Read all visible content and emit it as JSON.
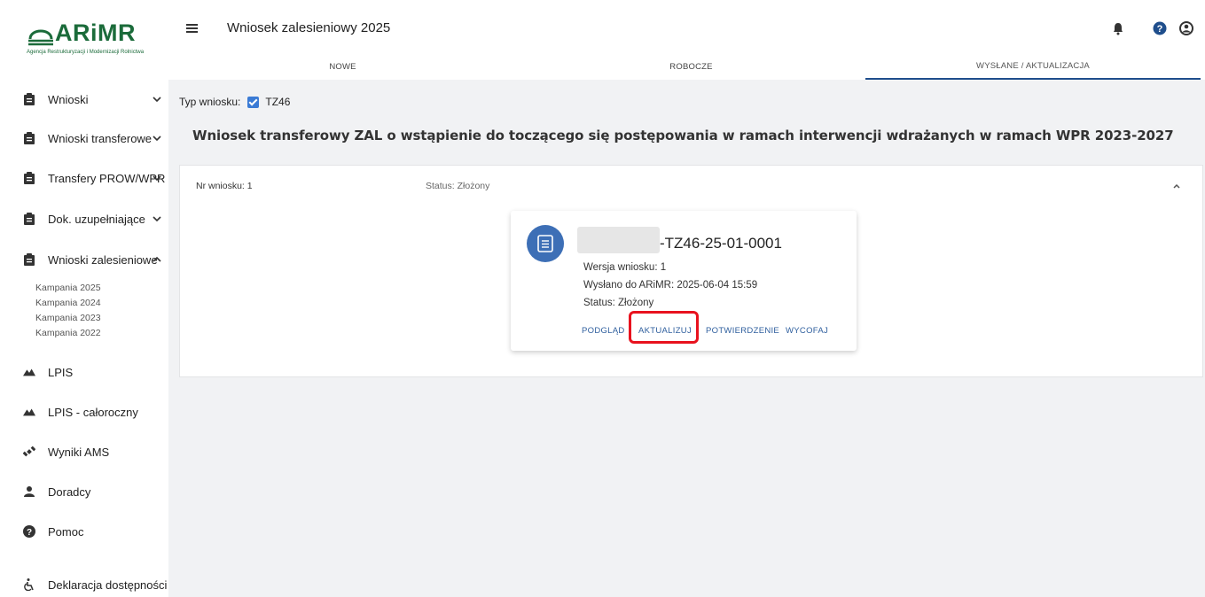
{
  "app": {
    "title": "Wniosek zalesieniowy 2025",
    "logo_text": "ARiMR",
    "logo_subtitle": "Agencja Restrukturyzacji i Modernizacji Rolnictwa"
  },
  "sidebar": {
    "items": [
      {
        "label": "Wnioski",
        "icon": "clipboard-icon",
        "chevron": "down"
      },
      {
        "label": "Wnioski transferowe",
        "icon": "clipboard-icon",
        "chevron": "down"
      },
      {
        "label": "Transfery PROW/WPR",
        "icon": "clipboard-icon",
        "chevron": "down"
      },
      {
        "label": "Dok. uzupełniające",
        "icon": "clipboard-icon",
        "chevron": "down"
      },
      {
        "label": "Wnioski zalesieniowe",
        "icon": "clipboard-icon",
        "chevron": "up"
      },
      {
        "label": "LPIS",
        "icon": "mountain-icon"
      },
      {
        "label": "LPIS - całoroczny",
        "icon": "mountain-icon"
      },
      {
        "label": "Wyniki AMS",
        "icon": "satellite-icon"
      },
      {
        "label": "Doradcy",
        "icon": "person-icon"
      },
      {
        "label": "Pomoc",
        "icon": "help-icon"
      },
      {
        "label": "Deklaracja dostępności",
        "icon": "accessibility-icon"
      }
    ],
    "subitems": [
      "Kampania 2025",
      "Kampania 2024",
      "Kampania 2023",
      "Kampania 2022"
    ]
  },
  "header": {
    "icons": [
      "bell-icon",
      "help-icon",
      "account-icon"
    ]
  },
  "tabs": [
    {
      "label": "NOWE",
      "active": false
    },
    {
      "label": "ROBOCZE",
      "active": false
    },
    {
      "label": "WYSŁANE / AKTUALIZACJA",
      "active": true
    }
  ],
  "main": {
    "filter_label": "Typ wniosku:",
    "filter_value": "TZ46",
    "filter_checked": true,
    "heading": "Wniosek transferowy ZAL o wstąpienie do toczącego się postępowania w ramach interwencji wdrażanych w ramach WPR 2023-2027"
  },
  "application": {
    "nr": "Nr wniosku: 1",
    "status": "Status: Złożony",
    "card": {
      "id_suffix": "-TZ46-25-01-0001",
      "version": "Wersja wniosku: 1",
      "sent": "Wysłano do ARiMR: 2025-06-04 15:59",
      "status": "Status: Złożony",
      "actions": [
        "PODGLĄD",
        "AKTUALIZUJ",
        "POTWIERDZENIE",
        "WYCOFAJ"
      ],
      "highlighted_action": "AKTUALIZUJ"
    }
  },
  "colors": {
    "brand_green": "#1b6b3a",
    "accent_blue": "#1f4e8c",
    "link_blue": "#2f5f9e",
    "highlight_red": "#e8121e"
  }
}
